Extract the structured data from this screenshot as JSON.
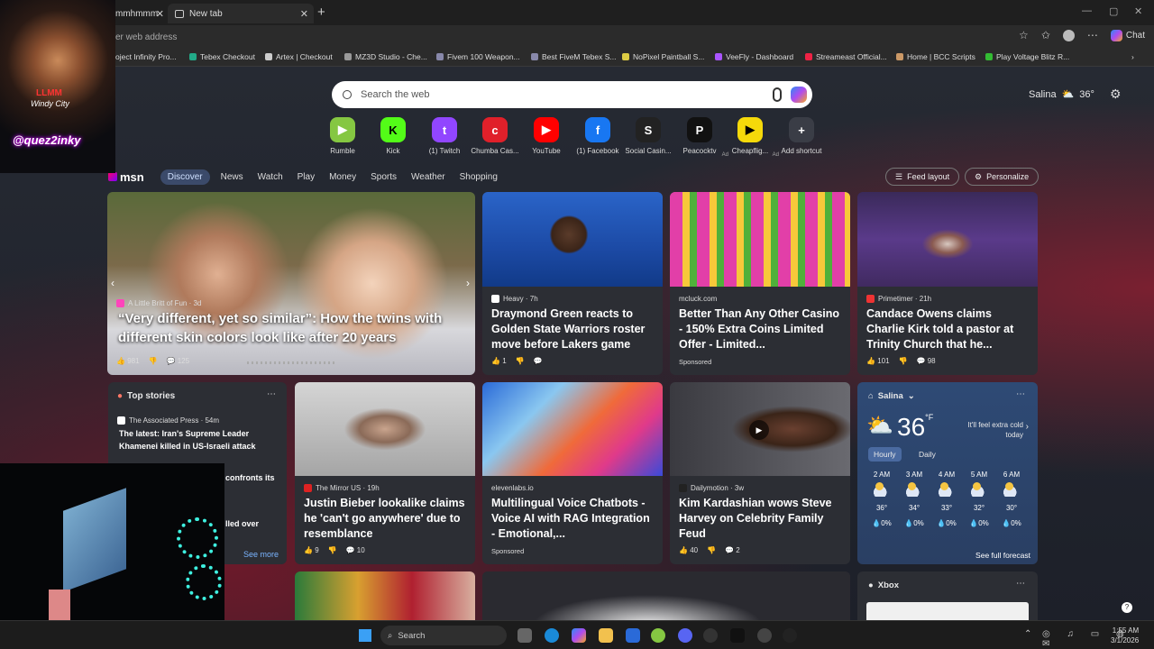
{
  "tabs": [
    {
      "label": "mmhmmm"
    },
    {
      "label": "New tab"
    }
  ],
  "address": {
    "placeholder": "er web address"
  },
  "chat_label": "Chat",
  "bookmarks": [
    "oject Infinity Pro...",
    "Tebex Checkout",
    "Artex | Checkout",
    "MZ3D Studio - Che...",
    "Fivem 100 Weapon...",
    "Best FiveM Tebex S...",
    "NoPixel Paintball S...",
    "VeeFly - Dashboard",
    "Streameast Official...",
    "Home | BCC Scripts",
    "Play Voltage Blitz R..."
  ],
  "search": {
    "placeholder": "Search the web"
  },
  "weather_top": {
    "city": "Salina",
    "temp": "36°"
  },
  "shortcuts": [
    {
      "label": "Rumble",
      "icon": "▶",
      "color": "#85c742"
    },
    {
      "label": "Kick",
      "icon": "K",
      "color": "#53fc18"
    },
    {
      "label": "(1) Twitch",
      "icon": "t",
      "color": "#9146ff"
    },
    {
      "label": "Chumba Cas...",
      "icon": "c",
      "color": "#e0202a"
    },
    {
      "label": "YouTube",
      "icon": "▶",
      "color": "#ff0000"
    },
    {
      "label": "(1) Facebook",
      "icon": "f",
      "color": "#1877f2"
    },
    {
      "label": "Social Casin...",
      "icon": "S",
      "color": "#222222"
    },
    {
      "label": "Peacocktv",
      "icon": "P",
      "color": "#111111",
      "ad": "Ad"
    },
    {
      "label": "Cheapflig...",
      "icon": "▶",
      "color": "#f5d90a",
      "ad": "Ad"
    },
    {
      "label": "Add shortcut",
      "icon": "+",
      "color": "#555555"
    }
  ],
  "nav": {
    "logo": "msn",
    "items": [
      "Discover",
      "News",
      "Watch",
      "Play",
      "Money",
      "Sports",
      "Weather",
      "Shopping"
    ],
    "feed_layout": "Feed layout",
    "personalize": "Personalize"
  },
  "hero": {
    "source": "A Little Britt of Fun · 3d",
    "title": "“Very different, yet so similar”: How the twins with different skin colors look like after 20 years",
    "likes": "981",
    "comments": "125"
  },
  "cards": [
    {
      "source": "Heavy · 7h",
      "title": "Draymond Green reacts to Golden State Warriors roster move before Lakers game",
      "likes": "1",
      "comments": ""
    },
    {
      "source": "mcluck.com",
      "title": "Better Than Any Other Casino - 150% Extra Coins Limited Offer - Limited...",
      "sponsored": "Sponsored"
    },
    {
      "source": "Primetimer · 21h",
      "title": "Candace Owens claims Charlie Kirk told a pastor at Trinity Church that he...",
      "likes": "101",
      "comments": "98"
    },
    {
      "source": "The Mirror US · 19h",
      "title": "Justin Bieber lookalike claims he 'can't go anywhere' due to resemblance",
      "likes": "9",
      "comments": "10"
    },
    {
      "source": "elevenlabs.io",
      "title": "Multilingual Voice Chatbots - Voice AI with RAG Integration - Emotional,...",
      "sponsored": "Sponsored"
    },
    {
      "source": "Dailymotion · 3w",
      "title": "Kim Kardashian wows Steve Harvey on Celebrity Family Feud",
      "likes": "40",
      "comments": "2"
    }
  ],
  "top_stories": {
    "title": "Top stories",
    "story1_source": "The Associated Press · 54m",
    "story1_title": "The latest: Iran's Supreme Leader Khamenei killed in US-Israeli attack",
    "frag1": "confronts its",
    "frag2": "lled over",
    "see_more": "See more"
  },
  "weather": {
    "city": "Salina",
    "temp": "36",
    "unit": "°F",
    "note": "It'll feel extra cold today",
    "tab_hourly": "Hourly",
    "tab_daily": "Daily",
    "hours": [
      {
        "t": "2 AM",
        "temp": "36°",
        "p": "0%"
      },
      {
        "t": "3 AM",
        "temp": "34°",
        "p": "0%"
      },
      {
        "t": "4 AM",
        "temp": "33°",
        "p": "0%"
      },
      {
        "t": "5 AM",
        "temp": "32°",
        "p": "0%"
      },
      {
        "t": "6 AM",
        "temp": "30°",
        "p": "0%"
      }
    ],
    "forecast": "See full forecast"
  },
  "xbox": {
    "title": "Xbox"
  },
  "webcam": {
    "line1": "LLMM",
    "line2": "Windy City",
    "handle": "@quez2inky"
  },
  "taskbar": {
    "search": "Search",
    "time": "1:55 AM",
    "date": "3/1/2026"
  }
}
